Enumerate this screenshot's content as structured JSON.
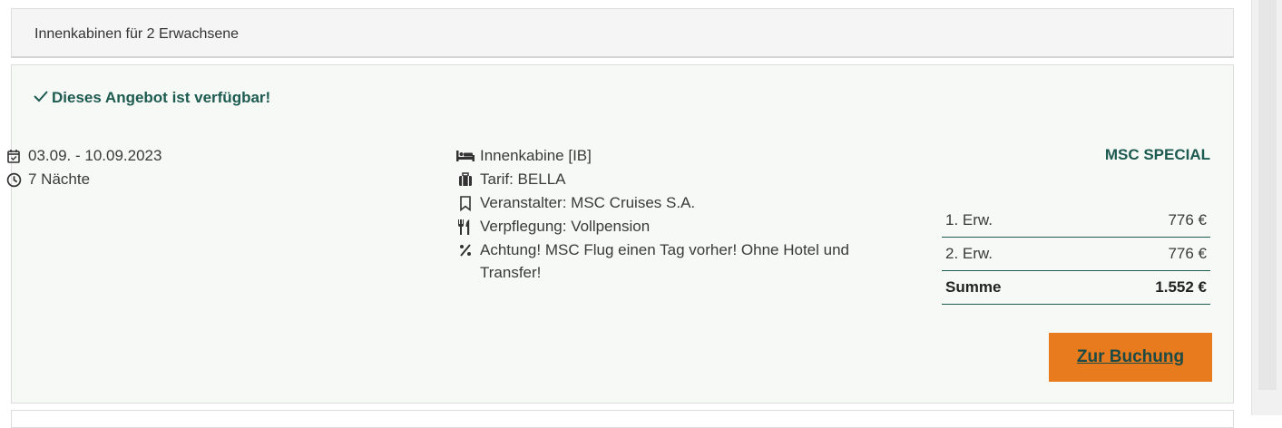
{
  "header": {
    "title": "Innenkabinen für 2 Erwachsene"
  },
  "offer": {
    "availability": "Dieses Angebot ist verfügbar!",
    "dates": "03.09. - 10.09.2023",
    "nights": "7 Nächte",
    "cabin": "Innenkabine [IB]",
    "tariff": "Tarif: BELLA",
    "operator": "Veranstalter: MSC Cruises S.A.",
    "board": "Verpflegung: Vollpension",
    "note": "Achtung! MSC Flug einen Tag vorher! Ohne Hotel und Transfer!",
    "badge": "MSC SPECIAL",
    "prices": [
      {
        "label": "1. Erw.",
        "value": "776 €"
      },
      {
        "label": "2. Erw.",
        "value": "776 €"
      }
    ],
    "total": {
      "label": "Summe",
      "value": "1.552 €"
    },
    "book_label": "Zur Buchung"
  },
  "colors": {
    "accent": "#1d5a4f",
    "button": "#e87b1e",
    "card_bg": "#f6f9f6"
  },
  "icons": [
    "check-icon",
    "calendar-icon",
    "clock-icon",
    "bed-icon",
    "suitcase-icon",
    "bookmark-icon",
    "cutlery-icon",
    "percent-icon"
  ]
}
